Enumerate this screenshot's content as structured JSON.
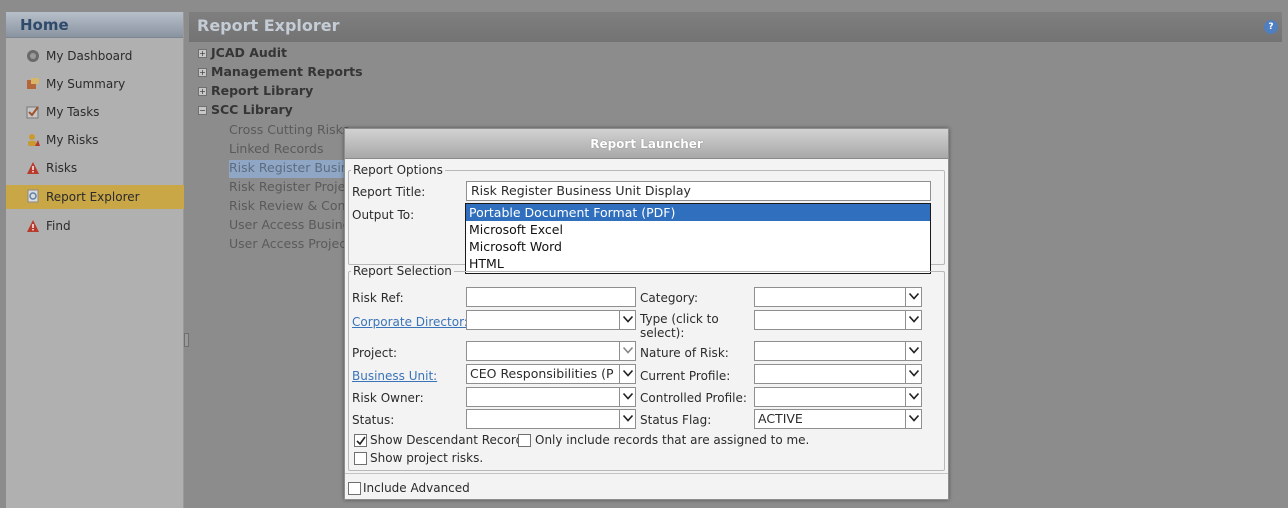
{
  "left_panel": {
    "title": "Home",
    "items": [
      {
        "label": "My Dashboard",
        "icon": "dashboard-icon"
      },
      {
        "label": "My Summary",
        "icon": "summary-icon"
      },
      {
        "label": "My Tasks",
        "icon": "tasks-icon"
      },
      {
        "label": "My Risks",
        "icon": "user-risks-icon"
      },
      {
        "label": "Risks",
        "icon": "warning-icon"
      },
      {
        "label": "Report Explorer",
        "icon": "report-explorer-icon"
      },
      {
        "label": "Find",
        "icon": "find-warning-icon"
      }
    ]
  },
  "main": {
    "title": "Report Explorer",
    "help_icon": "?",
    "tree": {
      "top": [
        "JCAD Audit",
        "Management Reports",
        "Report Library",
        "SCC Library"
      ],
      "children": [
        "Cross Cutting Risks",
        "Linked Records",
        "Risk Register Business",
        "Risk Register Project D",
        "Risk Review & Contro",
        "User Access Business",
        "User Access Project Re"
      ]
    }
  },
  "dialog": {
    "title": "Report Launcher",
    "report_options": {
      "legend": "Report Options",
      "report_title_label": "Report Title:",
      "report_title_value": "Risk Register Business Unit Display",
      "output_to_label": "Output To:",
      "output_options": [
        "Portable Document Format (PDF)",
        "Microsoft Excel",
        "Microsoft Word",
        "HTML"
      ]
    },
    "report_selection": {
      "legend": "Report Selection",
      "risk_ref_label": "Risk Ref:",
      "corporate_director_label": "Corporate Director:",
      "project_label": "Project:",
      "business_unit_label": "Business Unit:",
      "business_unit_value": "CEO Responsibilities (P Fla",
      "risk_owner_label": "Risk Owner:",
      "status_label": "Status:",
      "category_label": "Category:",
      "type_label_line1": "Type (click to",
      "type_label_line2": "select):",
      "nature_label": "Nature of Risk:",
      "current_profile_label": "Current Profile:",
      "controlled_profile_label": "Controlled Profile:",
      "status_flag_label": "Status Flag:",
      "status_flag_value": "ACTIVE",
      "show_descendant_label": "Show Descendant Records",
      "only_assigned_label": "Only include records that are assigned to me.",
      "show_project_label": "Show project risks."
    },
    "include_advanced_label": "Include Advanced"
  }
}
